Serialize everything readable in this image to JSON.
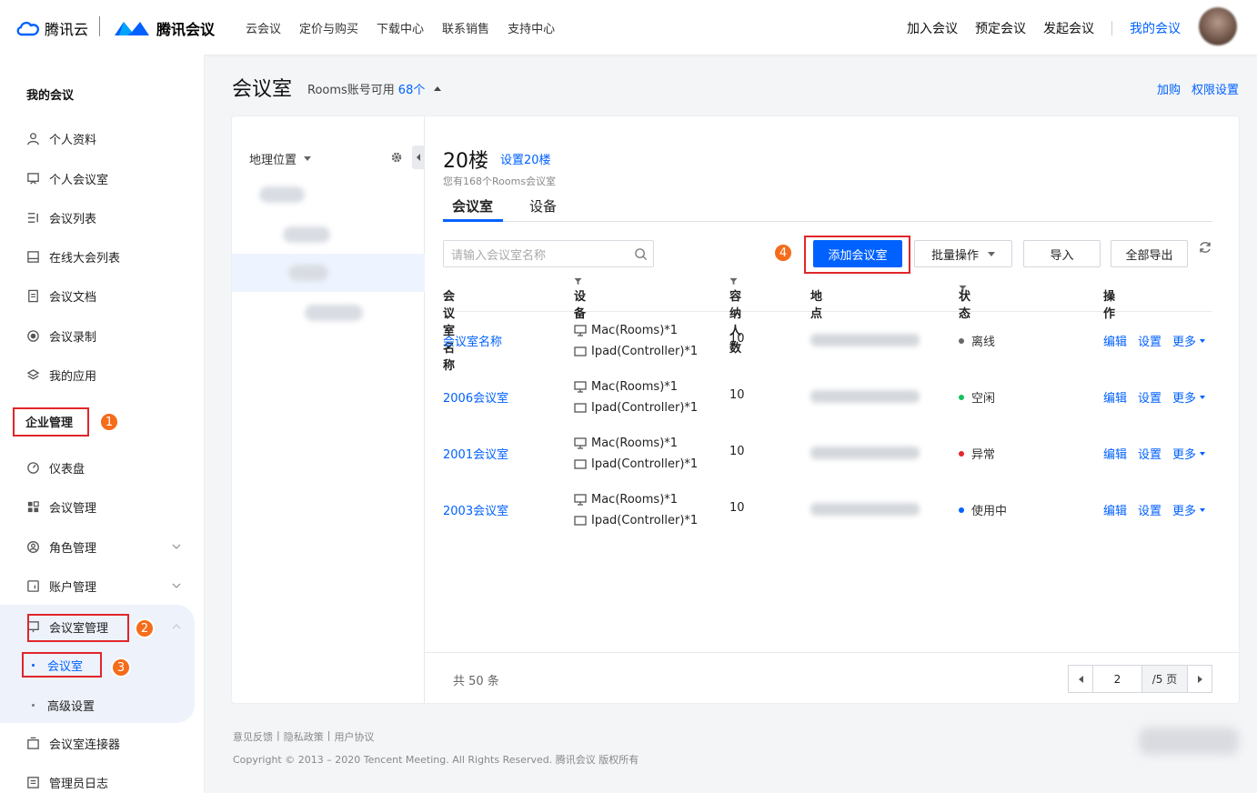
{
  "header": {
    "brand1": "腾讯云",
    "brand2": "腾讯会议",
    "nav": [
      "云会议",
      "定价与购买",
      "下载中心",
      "联系销售",
      "支持中心"
    ],
    "actions": [
      "加入会议",
      "预定会议",
      "发起会议"
    ],
    "mine": "我的会议"
  },
  "sidebar": {
    "title": "我的会议",
    "items": [
      "个人资料",
      "个人会议室",
      "会议列表",
      "在线大会列表",
      "会议文档",
      "会议录制",
      "我的应用"
    ],
    "enterprise": "企业管理",
    "ent_items": [
      "仪表盘",
      "会议管理",
      "角色管理",
      "账户管理"
    ],
    "room_group": "会议室管理",
    "room_sub": [
      "会议室",
      "高级设置"
    ],
    "after_items": [
      "会议室连接器",
      "管理员日志"
    ],
    "badges": [
      "1",
      "2",
      "3",
      "4"
    ]
  },
  "page": {
    "title": "会议室",
    "rooms_prefix": "Rooms账号可用",
    "rooms_count": "68个",
    "links": [
      "加购",
      "权限设置"
    ]
  },
  "tree": {
    "head": "地理位置"
  },
  "content": {
    "floor": "20楼",
    "floor_set": "设置20楼",
    "floor_sub": "您有168个Rooms会议室",
    "tabs": [
      "会议室",
      "设备"
    ],
    "search_placeholder": "请输入会议室名称",
    "buttons": {
      "add": "添加会议室",
      "batch": "批量操作",
      "import": "导入",
      "export": "全部导出"
    },
    "columns": [
      "会议室名称",
      "设备",
      "容纳人数",
      "地点",
      "状态",
      "操作"
    ],
    "rows": [
      {
        "name": "会议室名称",
        "dev1": "Mac(Rooms)*1",
        "dev2": "Ipad(Controller)*1",
        "cap": "10",
        "status": "离线",
        "status_color": "#666666"
      },
      {
        "name": "2006会议室",
        "dev1": "Mac(Rooms)*1",
        "dev2": "Ipad(Controller)*1",
        "cap": "10",
        "status": "空闲",
        "status_color": "#15c15d"
      },
      {
        "name": "2001会议室",
        "dev1": "Mac(Rooms)*1",
        "dev2": "Ipad(Controller)*1",
        "cap": "10",
        "status": "异常",
        "status_color": "#e5262b"
      },
      {
        "name": "2003会议室",
        "dev1": "Mac(Rooms)*1",
        "dev2": "Ipad(Controller)*1",
        "cap": "10",
        "status": "使用中",
        "status_color": "#0061ff"
      }
    ],
    "ops": [
      "编辑",
      "设置",
      "更多"
    ],
    "total": "共 50 条",
    "page_current": "2",
    "page_total": "/5 页"
  },
  "footer": {
    "links": [
      "意见反馈",
      "|",
      "隐私政策",
      "|",
      "用户协议"
    ],
    "copyright": "Copyright © 2013 – 2020 Tencent Meeting. All Rights Reserved.  腾讯会议 版权所有"
  }
}
